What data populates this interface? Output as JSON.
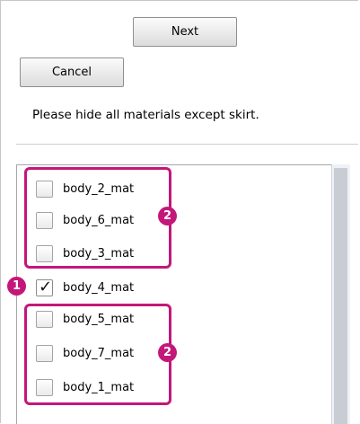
{
  "buttons": {
    "next": "Next",
    "cancel": "Cancel"
  },
  "instruction": "Please hide all materials except skirt.",
  "materials": [
    {
      "label": "body_2_mat",
      "checked": false
    },
    {
      "label": "body_6_mat",
      "checked": false
    },
    {
      "label": "body_3_mat",
      "checked": false
    },
    {
      "label": "body_4_mat",
      "checked": true
    },
    {
      "label": "body_5_mat",
      "checked": false
    },
    {
      "label": "body_7_mat",
      "checked": false
    },
    {
      "label": "body_1_mat",
      "checked": false
    }
  ],
  "callouts": {
    "one": "1",
    "two": "2"
  },
  "colors": {
    "callout": "#c4177a"
  }
}
